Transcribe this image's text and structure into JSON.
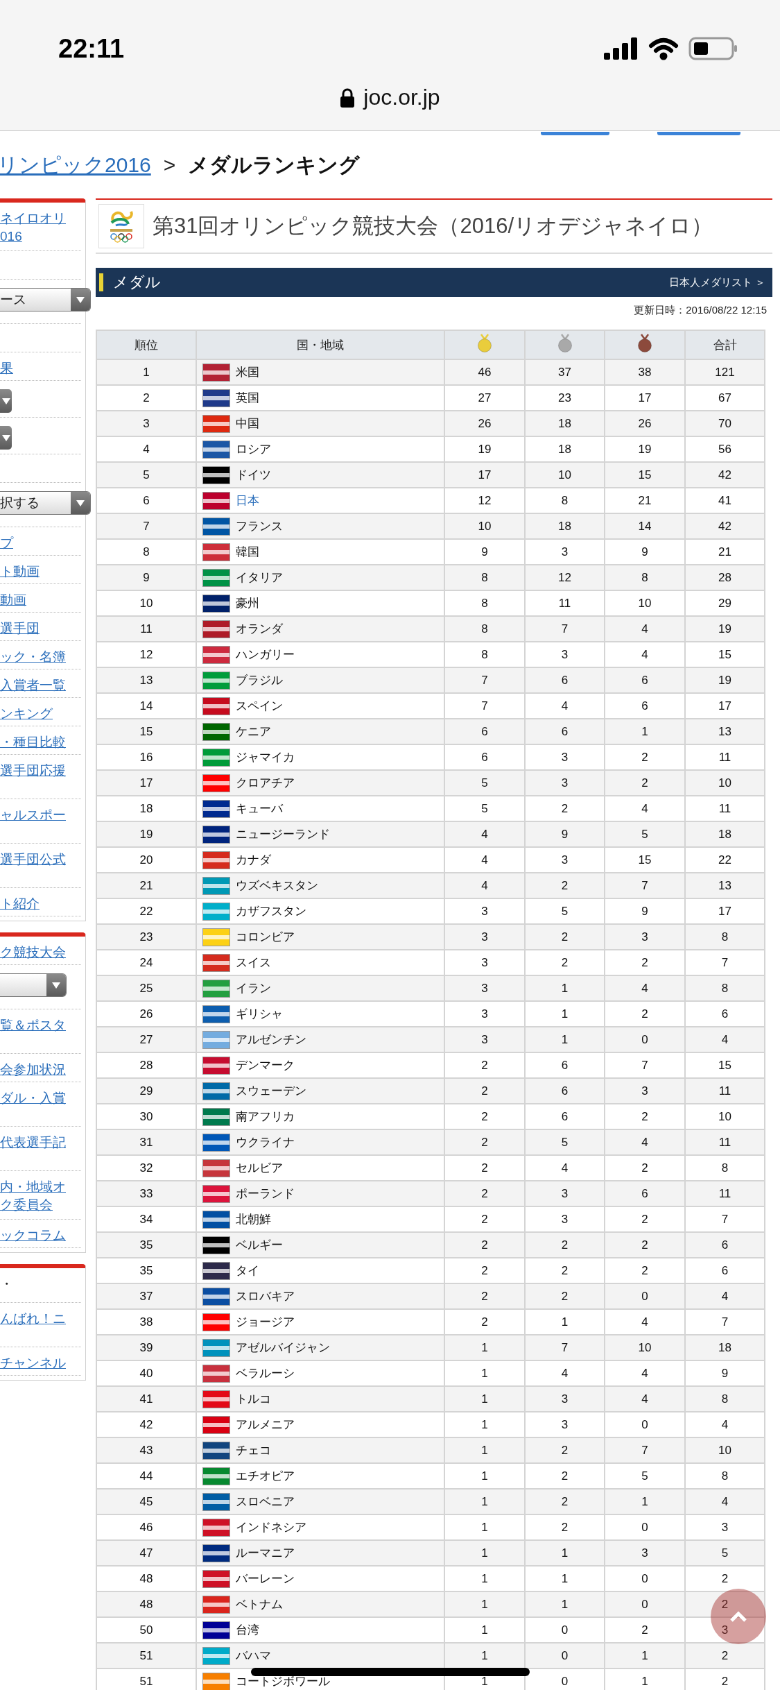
{
  "browser": {
    "time": "22:11",
    "url": "joc.or.jp"
  },
  "breadcrumb": [
    [
      {
        "kind": "link",
        "text": "リンピック2016"
      },
      {
        "kind": "separator",
        "text": ">"
      },
      {
        "kind": "current",
        "text": "メダルランキング"
      }
    ]
  ],
  "sidebar": [
    {
      "items": [
        {
          "kind": "link",
          "lines": [
            "ネイロオリ",
            "016"
          ]
        },
        {
          "kind": "blank"
        },
        {
          "kind": "select",
          "text": "ース"
        },
        {
          "kind": "blank"
        },
        {
          "kind": "link",
          "lines": [
            "果"
          ]
        },
        {
          "kind": "arrow-select"
        },
        {
          "kind": "arrow-select"
        },
        {
          "kind": "blank"
        },
        {
          "kind": "select",
          "text": "択する"
        },
        {
          "kind": "link",
          "lines": [
            "プ"
          ]
        },
        {
          "kind": "link",
          "lines": [
            "ト動画"
          ]
        },
        {
          "kind": "link",
          "lines": [
            "動画"
          ]
        },
        {
          "kind": "link",
          "lines": [
            "選手団"
          ]
        },
        {
          "kind": "link",
          "lines": [
            "ック・名簿"
          ]
        },
        {
          "kind": "link",
          "lines": [
            "入賞者一覧"
          ]
        },
        {
          "kind": "link",
          "lines": [
            "ンキング"
          ]
        },
        {
          "kind": "link",
          "lines": [
            "・種目比較"
          ]
        },
        {
          "kind": "wrapped-link",
          "lines": [
            "選手団応援"
          ]
        },
        {
          "kind": "wrapped-link",
          "lines": [
            "ャルスポー"
          ]
        },
        {
          "kind": "wrapped-link",
          "lines": [
            "選手団公式"
          ]
        },
        {
          "kind": "link",
          "lines": [
            "ト紹介"
          ]
        }
      ]
    },
    {
      "items": [
        {
          "kind": "link",
          "lines": [
            "ク競技大会"
          ]
        },
        {
          "kind": "short-select"
        },
        {
          "kind": "wrapped-link",
          "lines": [
            "覧＆ポスタ"
          ]
        },
        {
          "kind": "link",
          "lines": [
            "会参加状況"
          ]
        },
        {
          "kind": "wrapped-link",
          "lines": [
            "ダル・入賞"
          ]
        },
        {
          "kind": "wrapped-link",
          "lines": [
            "代表選手記"
          ]
        },
        {
          "kind": "link",
          "lines": [
            "内・地域オ",
            "ク委員会"
          ]
        },
        {
          "kind": "link",
          "lines": [
            "ックコラム"
          ]
        }
      ]
    },
    {
      "items": [
        {
          "kind": "text",
          "lines": [
            "・"
          ]
        },
        {
          "kind": "wrapped-link",
          "lines": [
            "んばれ！ニ"
          ]
        },
        {
          "kind": "link",
          "lines": [
            "チャンネル"
          ]
        }
      ]
    }
  ],
  "event": {
    "title": "第31回オリンピック競技大会（2016/リオデジャネイロ）"
  },
  "section": {
    "title": "メダル",
    "link": "日本人メダリスト ＞"
  },
  "updated": "更新日時：2016/08/22 12:15",
  "table": {
    "columns": [
      {
        "kind": "label",
        "label": "順位"
      },
      {
        "kind": "label",
        "label": "国・地域"
      },
      {
        "kind": "medal",
        "color": "#e9cd3c"
      },
      {
        "kind": "medal",
        "color": "#a9a9a9"
      },
      {
        "kind": "medal",
        "color": "#8c4a3c"
      },
      {
        "kind": "label",
        "label": "合計"
      }
    ],
    "rows": [
      {
        "rank": "1",
        "country": "米国",
        "color": "#b22234",
        "gold": "46",
        "silver": "37",
        "bronze": "38",
        "total": "121",
        "link": false
      },
      {
        "rank": "2",
        "country": "英国",
        "color": "#1f3a8a",
        "gold": "27",
        "silver": "23",
        "bronze": "17",
        "total": "67",
        "link": false
      },
      {
        "rank": "3",
        "country": "中国",
        "color": "#de2910",
        "gold": "26",
        "silver": "18",
        "bronze": "26",
        "total": "70",
        "link": false
      },
      {
        "rank": "4",
        "country": "ロシア",
        "color": "#1c57a5",
        "gold": "19",
        "silver": "18",
        "bronze": "19",
        "total": "56",
        "link": false
      },
      {
        "rank": "5",
        "country": "ドイツ",
        "color": "#000000",
        "gold": "17",
        "silver": "10",
        "bronze": "15",
        "total": "42",
        "link": false
      },
      {
        "rank": "6",
        "country": "日本",
        "color": "#bc002d",
        "gold": "12",
        "silver": "8",
        "bronze": "21",
        "total": "41",
        "link": true
      },
      {
        "rank": "7",
        "country": "フランス",
        "color": "#0055a4",
        "gold": "10",
        "silver": "18",
        "bronze": "14",
        "total": "42",
        "link": false
      },
      {
        "rank": "8",
        "country": "韓国",
        "color": "#cd2e3a",
        "gold": "9",
        "silver": "3",
        "bronze": "9",
        "total": "21",
        "link": false
      },
      {
        "rank": "9",
        "country": "イタリア",
        "color": "#009246",
        "gold": "8",
        "silver": "12",
        "bronze": "8",
        "total": "28",
        "link": false
      },
      {
        "rank": "10",
        "country": "豪州",
        "color": "#012169",
        "gold": "8",
        "silver": "11",
        "bronze": "10",
        "total": "29",
        "link": false
      },
      {
        "rank": "11",
        "country": "オランダ",
        "color": "#ae1c28",
        "gold": "8",
        "silver": "7",
        "bronze": "4",
        "total": "19",
        "link": false
      },
      {
        "rank": "12",
        "country": "ハンガリー",
        "color": "#cd2a3e",
        "gold": "8",
        "silver": "3",
        "bronze": "4",
        "total": "15",
        "link": false
      },
      {
        "rank": "13",
        "country": "ブラジル",
        "color": "#009c3b",
        "gold": "7",
        "silver": "6",
        "bronze": "6",
        "total": "19",
        "link": false
      },
      {
        "rank": "14",
        "country": "スペイン",
        "color": "#c60b1e",
        "gold": "7",
        "silver": "4",
        "bronze": "6",
        "total": "17",
        "link": false
      },
      {
        "rank": "15",
        "country": "ケニア",
        "color": "#006600",
        "gold": "6",
        "silver": "6",
        "bronze": "1",
        "total": "13",
        "link": false
      },
      {
        "rank": "16",
        "country": "ジャマイカ",
        "color": "#009b3a",
        "gold": "6",
        "silver": "3",
        "bronze": "2",
        "total": "11",
        "link": false
      },
      {
        "rank": "17",
        "country": "クロアチア",
        "color": "#ff0000",
        "gold": "5",
        "silver": "3",
        "bronze": "2",
        "total": "10",
        "link": false
      },
      {
        "rank": "18",
        "country": "キューバ",
        "color": "#002a8f",
        "gold": "5",
        "silver": "2",
        "bronze": "4",
        "total": "11",
        "link": false
      },
      {
        "rank": "19",
        "country": "ニュージーランド",
        "color": "#00247d",
        "gold": "4",
        "silver": "9",
        "bronze": "5",
        "total": "18",
        "link": false
      },
      {
        "rank": "20",
        "country": "カナダ",
        "color": "#d52b1e",
        "gold": "4",
        "silver": "3",
        "bronze": "15",
        "total": "22",
        "link": false
      },
      {
        "rank": "21",
        "country": "ウズベキスタン",
        "color": "#0099b5",
        "gold": "4",
        "silver": "2",
        "bronze": "7",
        "total": "13",
        "link": false
      },
      {
        "rank": "22",
        "country": "カザフスタン",
        "color": "#00afca",
        "gold": "3",
        "silver": "5",
        "bronze": "9",
        "total": "17",
        "link": false
      },
      {
        "rank": "23",
        "country": "コロンビア",
        "color": "#fcd116",
        "gold": "3",
        "silver": "2",
        "bronze": "3",
        "total": "8",
        "link": false
      },
      {
        "rank": "24",
        "country": "スイス",
        "color": "#d52b1e",
        "gold": "3",
        "silver": "2",
        "bronze": "2",
        "total": "7",
        "link": false
      },
      {
        "rank": "25",
        "country": "イラン",
        "color": "#239f40",
        "gold": "3",
        "silver": "1",
        "bronze": "4",
        "total": "8",
        "link": false
      },
      {
        "rank": "26",
        "country": "ギリシャ",
        "color": "#0d5eaf",
        "gold": "3",
        "silver": "1",
        "bronze": "2",
        "total": "6",
        "link": false
      },
      {
        "rank": "27",
        "country": "アルゼンチン",
        "color": "#74acdf",
        "gold": "3",
        "silver": "1",
        "bronze": "0",
        "total": "4",
        "link": false
      },
      {
        "rank": "28",
        "country": "デンマーク",
        "color": "#c60c30",
        "gold": "2",
        "silver": "6",
        "bronze": "7",
        "total": "15",
        "link": false
      },
      {
        "rank": "29",
        "country": "スウェーデン",
        "color": "#006aa7",
        "gold": "2",
        "silver": "6",
        "bronze": "3",
        "total": "11",
        "link": false
      },
      {
        "rank": "30",
        "country": "南アフリカ",
        "color": "#007a4d",
        "gold": "2",
        "silver": "6",
        "bronze": "2",
        "total": "10",
        "link": false
      },
      {
        "rank": "31",
        "country": "ウクライナ",
        "color": "#0057b7",
        "gold": "2",
        "silver": "5",
        "bronze": "4",
        "total": "11",
        "link": false
      },
      {
        "rank": "32",
        "country": "セルビア",
        "color": "#c6363c",
        "gold": "2",
        "silver": "4",
        "bronze": "2",
        "total": "8",
        "link": false
      },
      {
        "rank": "33",
        "country": "ポーランド",
        "color": "#dc143c",
        "gold": "2",
        "silver": "3",
        "bronze": "6",
        "total": "11",
        "link": false
      },
      {
        "rank": "34",
        "country": "北朝鮮",
        "color": "#024fa2",
        "gold": "2",
        "silver": "3",
        "bronze": "2",
        "total": "7",
        "link": false
      },
      {
        "rank": "35",
        "country": "ベルギー",
        "color": "#000000",
        "gold": "2",
        "silver": "2",
        "bronze": "2",
        "total": "6",
        "link": false
      },
      {
        "rank": "35",
        "country": "タイ",
        "color": "#2d2a4a",
        "gold": "2",
        "silver": "2",
        "bronze": "2",
        "total": "6",
        "link": false
      },
      {
        "rank": "37",
        "country": "スロバキア",
        "color": "#0b4ea2",
        "gold": "2",
        "silver": "2",
        "bronze": "0",
        "total": "4",
        "link": false
      },
      {
        "rank": "38",
        "country": "ジョージア",
        "color": "#ff0000",
        "gold": "2",
        "silver": "1",
        "bronze": "4",
        "total": "7",
        "link": false
      },
      {
        "rank": "39",
        "country": "アゼルバイジャン",
        "color": "#0092bc",
        "gold": "1",
        "silver": "7",
        "bronze": "10",
        "total": "18",
        "link": false
      },
      {
        "rank": "40",
        "country": "ベラルーシ",
        "color": "#c8313e",
        "gold": "1",
        "silver": "4",
        "bronze": "4",
        "total": "9",
        "link": false
      },
      {
        "rank": "41",
        "country": "トルコ",
        "color": "#e30a17",
        "gold": "1",
        "silver": "3",
        "bronze": "4",
        "total": "8",
        "link": false
      },
      {
        "rank": "42",
        "country": "アルメニア",
        "color": "#d90012",
        "gold": "1",
        "silver": "3",
        "bronze": "0",
        "total": "4",
        "link": false
      },
      {
        "rank": "43",
        "country": "チェコ",
        "color": "#11457e",
        "gold": "1",
        "silver": "2",
        "bronze": "7",
        "total": "10",
        "link": false
      },
      {
        "rank": "44",
        "country": "エチオピア",
        "color": "#078930",
        "gold": "1",
        "silver": "2",
        "bronze": "5",
        "total": "8",
        "link": false
      },
      {
        "rank": "45",
        "country": "スロベニア",
        "color": "#005da4",
        "gold": "1",
        "silver": "2",
        "bronze": "1",
        "total": "4",
        "link": false
      },
      {
        "rank": "46",
        "country": "インドネシア",
        "color": "#ce1126",
        "gold": "1",
        "silver": "2",
        "bronze": "0",
        "total": "3",
        "link": false
      },
      {
        "rank": "47",
        "country": "ルーマニア",
        "color": "#002b7f",
        "gold": "1",
        "silver": "1",
        "bronze": "3",
        "total": "5",
        "link": false
      },
      {
        "rank": "48",
        "country": "バーレーン",
        "color": "#ce1126",
        "gold": "1",
        "silver": "1",
        "bronze": "0",
        "total": "2",
        "link": false
      },
      {
        "rank": "48",
        "country": "ベトナム",
        "color": "#da251d",
        "gold": "1",
        "silver": "1",
        "bronze": "0",
        "total": "2",
        "link": false
      },
      {
        "rank": "50",
        "country": "台湾",
        "color": "#000095",
        "gold": "1",
        "silver": "0",
        "bronze": "2",
        "total": "3",
        "link": false
      },
      {
        "rank": "51",
        "country": "バハマ",
        "color": "#00abc9",
        "gold": "1",
        "silver": "0",
        "bronze": "1",
        "total": "2",
        "link": false
      },
      {
        "rank": "51",
        "country": "コートジボワール",
        "color": "#f77f00",
        "gold": "1",
        "silver": "0",
        "bronze": "1",
        "total": "2",
        "link": false
      }
    ]
  }
}
